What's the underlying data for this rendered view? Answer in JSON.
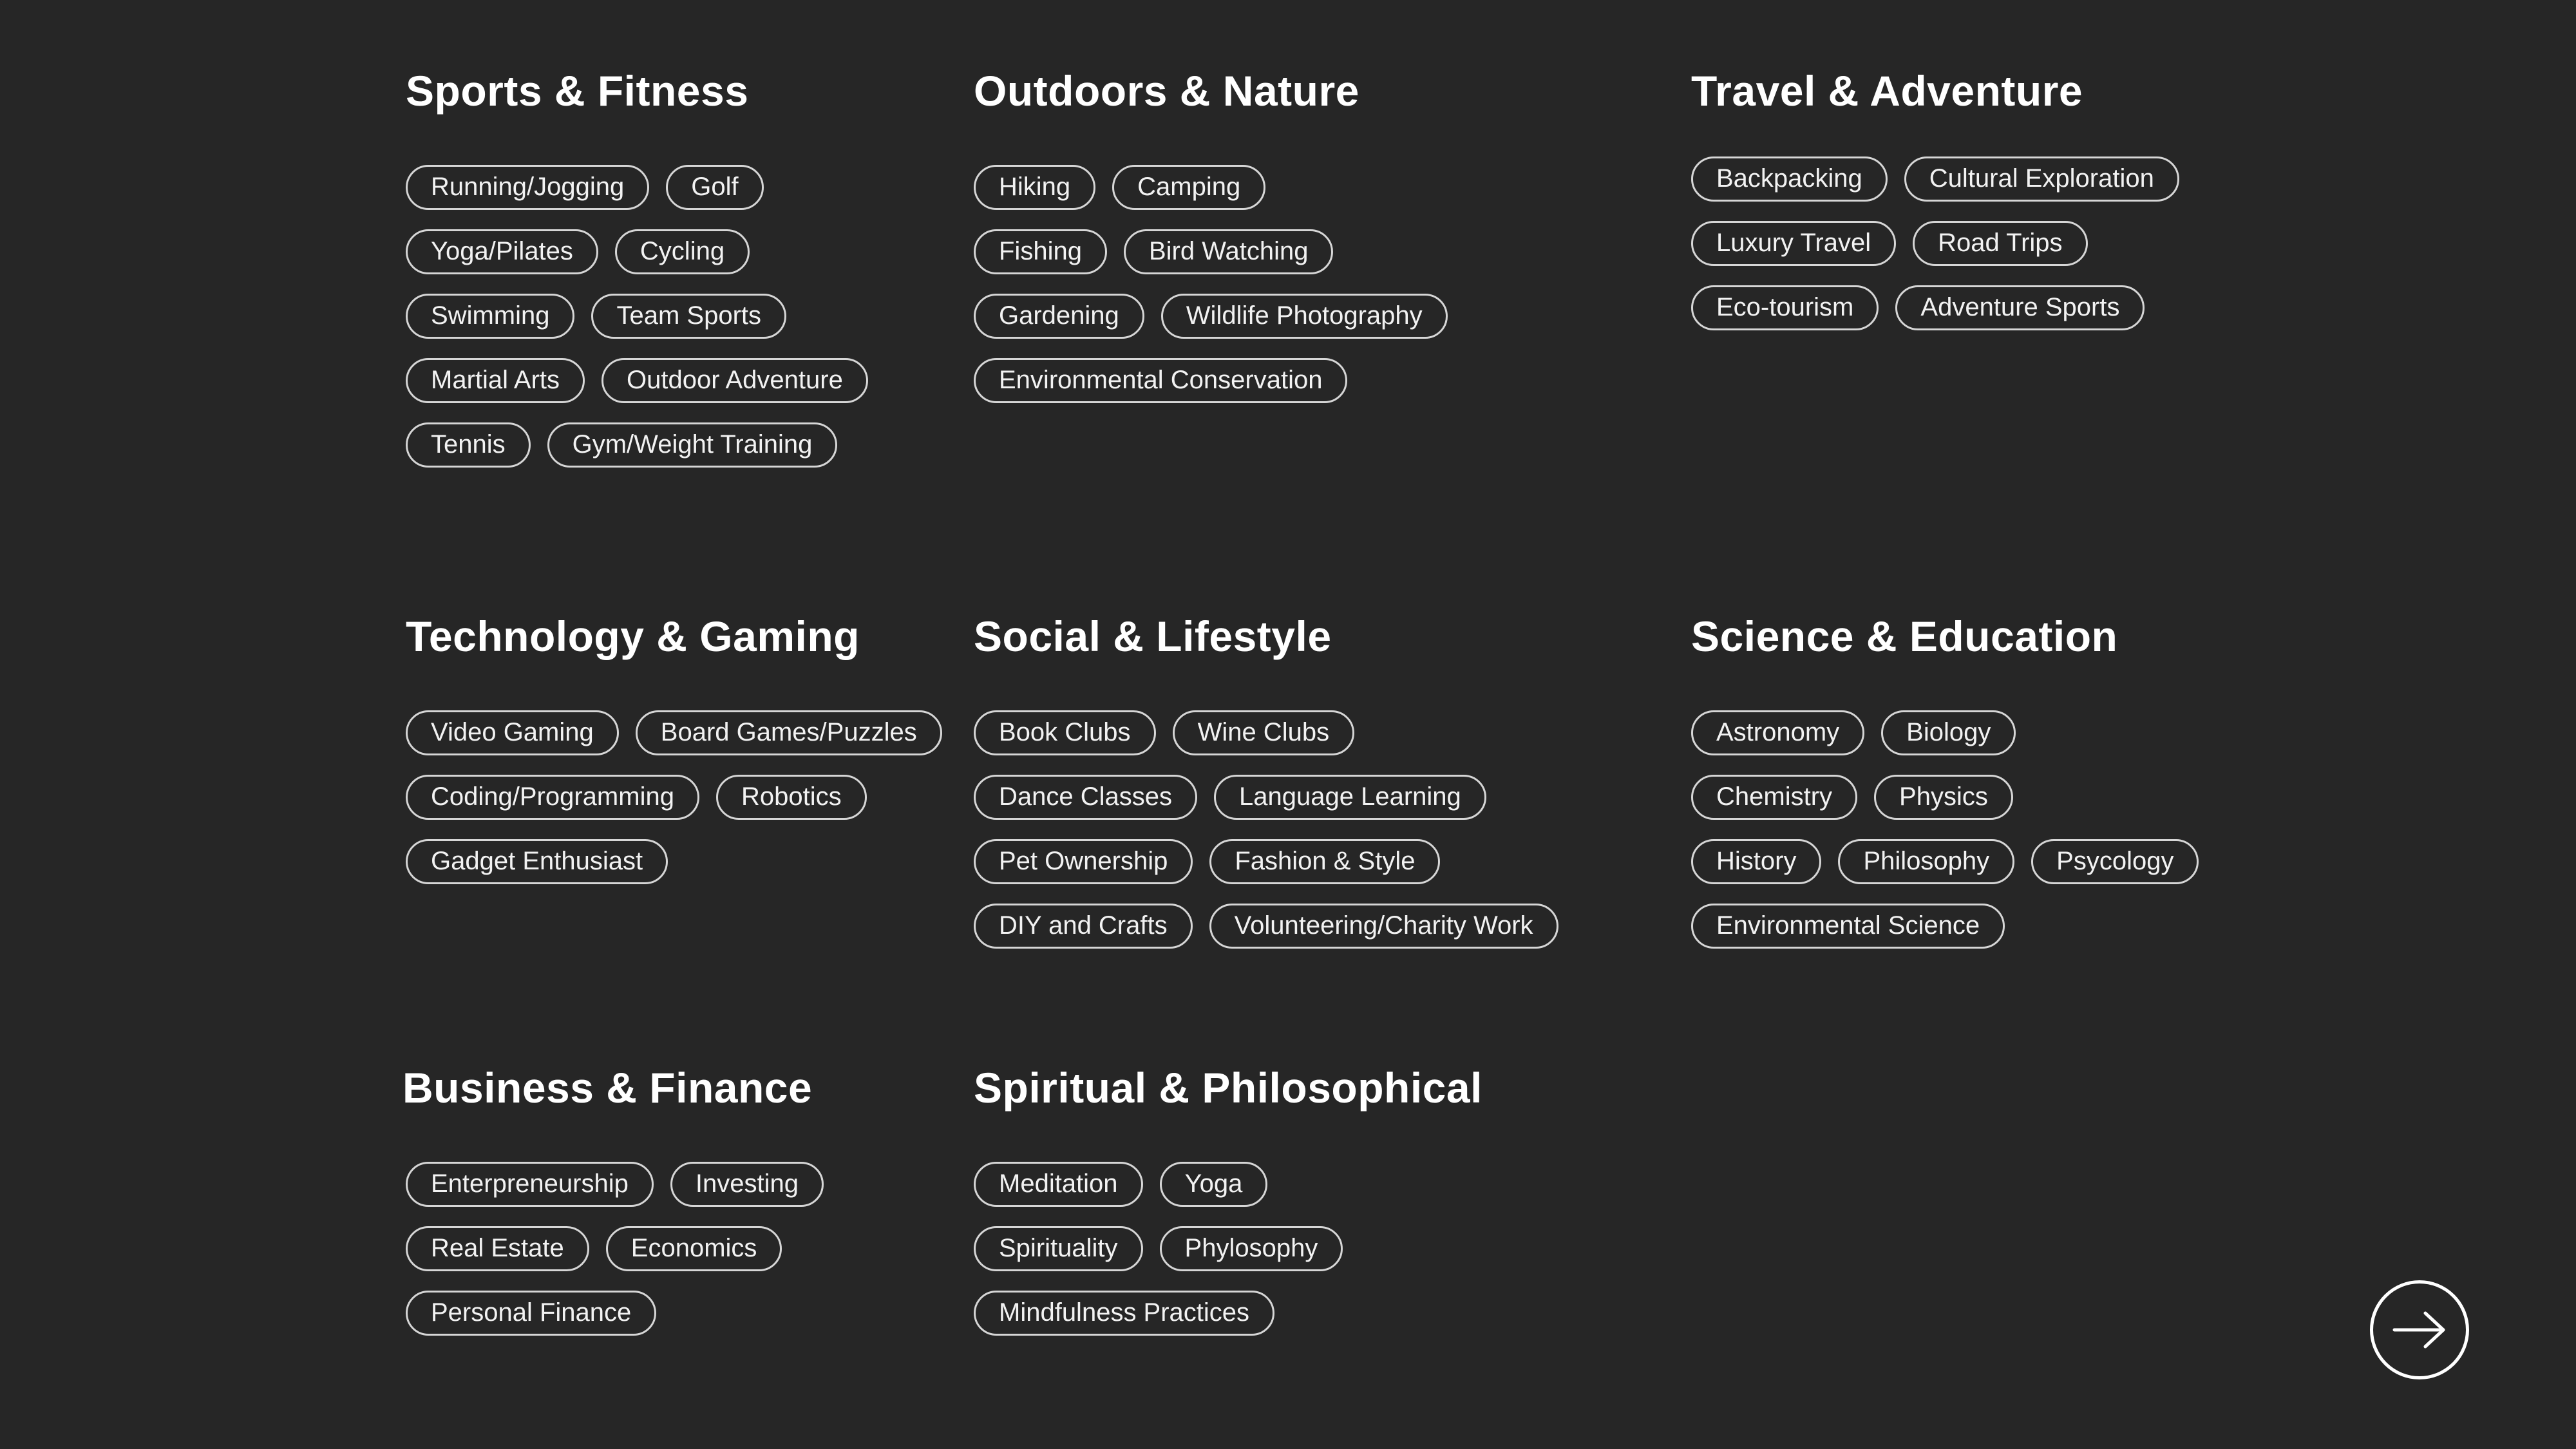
{
  "categories": [
    {
      "title": "Sports & Fitness",
      "rows": [
        [
          "Running/Jogging",
          "Golf"
        ],
        [
          "Yoga/Pilates",
          "Cycling"
        ],
        [
          "Swimming",
          "Team Sports"
        ],
        [
          "Martial Arts",
          "Outdoor Adventure"
        ],
        [
          "Tennis",
          "Gym/Weight Training"
        ]
      ]
    },
    {
      "title": "Outdoors & Nature",
      "rows": [
        [
          "Hiking",
          "Camping"
        ],
        [
          "Fishing",
          "Bird Watching"
        ],
        [
          "Gardening",
          "Wildlife Photography"
        ],
        [
          "Environmental Conservation"
        ]
      ]
    },
    {
      "title": "Travel & Adventure",
      "rows": [
        [
          "Backpacking",
          "Cultural Exploration"
        ],
        [
          "Luxury Travel",
          "Road Trips"
        ],
        [
          "Eco-tourism",
          "Adventure Sports"
        ]
      ]
    },
    {
      "title": "Technology & Gaming",
      "rows": [
        [
          "Video Gaming",
          "Board Games/Puzzles"
        ],
        [
          "Coding/Programming",
          "Robotics"
        ],
        [
          "Gadget Enthusiast"
        ]
      ]
    },
    {
      "title": "Social & Lifestyle",
      "rows": [
        [
          "Book Clubs",
          "Wine Clubs"
        ],
        [
          "Dance Classes",
          "Language Learning"
        ],
        [
          "Pet Ownership",
          "Fashion & Style"
        ],
        [
          "DIY and Crafts",
          "Volunteering/Charity Work"
        ]
      ]
    },
    {
      "title": "Science & Education",
      "rows": [
        [
          "Astronomy",
          "Biology"
        ],
        [
          "Chemistry",
          "Physics"
        ],
        [
          "History",
          "Philosophy",
          "Psycology"
        ],
        [
          "Environmental Science"
        ]
      ]
    },
    {
      "title": "Business & Finance",
      "rows": [
        [
          "Enterpreneurship",
          "Investing"
        ],
        [
          "Real Estate",
          "Economics"
        ],
        [
          "Personal Finance"
        ]
      ]
    },
    {
      "title": "Spiritual & Philosophical",
      "rows": [
        [
          "Meditation",
          "Yoga"
        ],
        [
          "Spirituality",
          "Phylosophy"
        ],
        [
          "Mindfulness Practices"
        ]
      ]
    }
  ],
  "next_button": {
    "icon": "arrow-right-icon"
  },
  "colors": {
    "background": "#262626",
    "text": "#ffffff",
    "tag_border": "#d6d6d6"
  }
}
